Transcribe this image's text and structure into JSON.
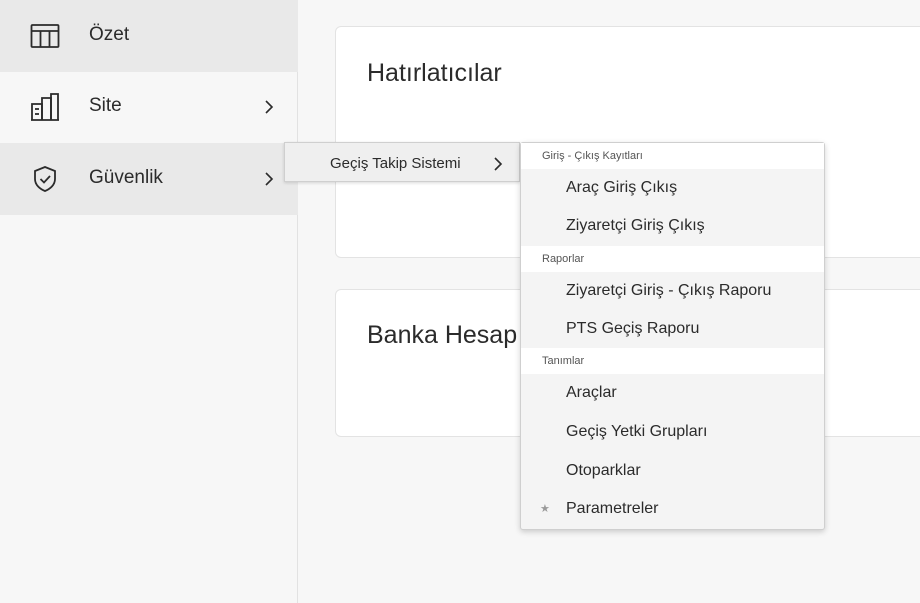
{
  "sidebar": {
    "items": [
      {
        "label": "Özet",
        "icon": "table-icon"
      },
      {
        "label": "Site",
        "icon": "building-icon"
      },
      {
        "label": "Güvenlik",
        "icon": "shield-check-icon"
      }
    ]
  },
  "main": {
    "cards": [
      {
        "title": "Hatırlatıcılar"
      },
      {
        "title": "Banka Hesap"
      }
    ]
  },
  "flyout": {
    "level1": {
      "label": "Geçiş Takip Sistemi"
    },
    "groups": [
      {
        "header": "Giriş - Çıkış Kayıtları",
        "items": [
          "Araç Giriş Çıkış",
          "Ziyaretçi Giriş Çıkış"
        ]
      },
      {
        "header": "Raporlar",
        "items": [
          "Ziyaretçi Giriş - Çıkış Raporu",
          "PTS Geçiş Raporu"
        ]
      },
      {
        "header": "Tanımlar",
        "items": [
          "Araçlar",
          "Geçiş Yetki Grupları",
          "Otoparklar",
          "Parametreler"
        ]
      }
    ],
    "star_symbol": "★"
  },
  "colors": {
    "active_bg": "#e9e9e9",
    "text": "#2b2b2b"
  }
}
